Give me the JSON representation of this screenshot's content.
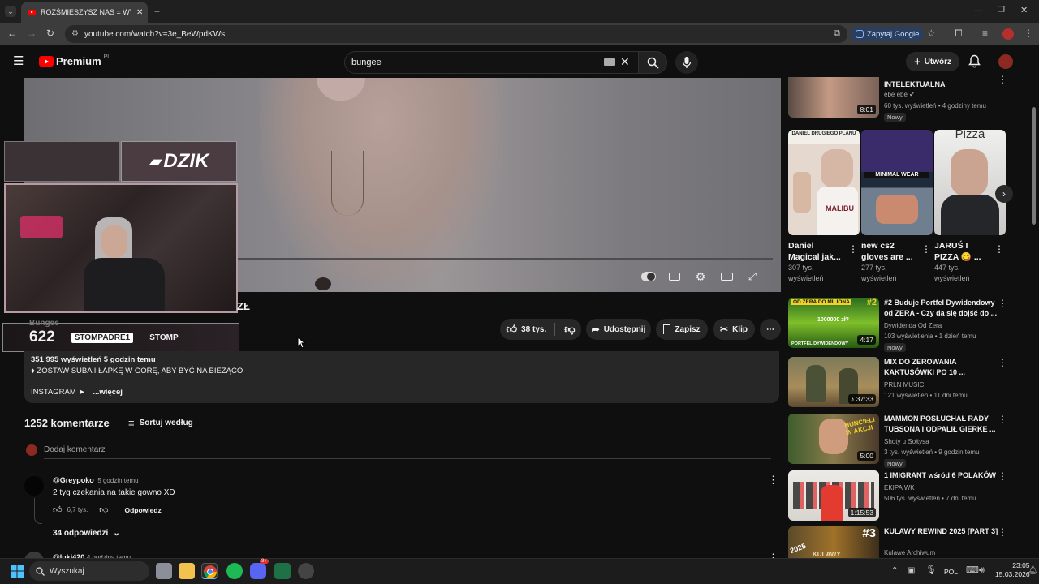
{
  "browser": {
    "tab_title": "ROZŚMIESZYSZ NAS = WYGRY",
    "url": "youtube.com/watch?v=3e_BeWpdKWs",
    "ask_google": "Zapytaj Google"
  },
  "youtube": {
    "logo_text": "Premium",
    "logo_region": "PL",
    "search_value": "bungee",
    "create_label": "Utwórz"
  },
  "player": {
    "overlay_brand": "DZIK",
    "overlay_count": "622",
    "overlay_social1": "STOMPADRE1",
    "overlay_social2": "STOMP"
  },
  "video": {
    "title_fragment": "ZŁ",
    "channel": "Bungee",
    "likes": "38 tys.",
    "share": "Udostępnij",
    "save": "Zapisz",
    "clip": "Klip",
    "views_line": "351 995 wyświetleń  5 godzin temu",
    "desc_line": "♦ ZOSTAW SUBA I ŁAPKĘ W GÓRĘ, ABY BYĆ NA BIEŻĄCO",
    "instagram": "INSTAGRAM ►",
    "more": "...więcej"
  },
  "comments": {
    "count": "1252 komentarze",
    "sort": "Sortuj według",
    "add_placeholder": "Dodaj komentarz",
    "items": [
      {
        "author": "@Greypoko",
        "time": "5 godzin temu",
        "text": "2 tyg czekania na takie gowno XD",
        "likes": "6,7 tys.",
        "reply": "Odpowiedz",
        "replies": "34 odpowiedzi"
      },
      {
        "author": "@luki420",
        "time": "4 godziny temu"
      }
    ]
  },
  "sidebar": {
    "top": {
      "title": "INTELEKTUALNA",
      "channel": "ebe ebe",
      "meta": "60 tys. wyświetleń • 4 godziny temu",
      "badge": "Nowy",
      "duration": "8:01"
    },
    "shorts": [
      {
        "title": "Daniel Magical jak...",
        "views": "307 tys. wyświetleń",
        "thumb_text": "DANIEL DRUGIEGO PLANU",
        "thumb_text2": "MALIBU"
      },
      {
        "title": "new cs2 gloves are ...",
        "views": "277 tys. wyświetleń",
        "thumb_text": "MINIMAL WEAR"
      },
      {
        "title": "JARUŚ I PIZZA 😋 ...",
        "views": "447 tys. wyświetleń",
        "thumb_text": "Pizza"
      }
    ],
    "videos": [
      {
        "title": "#2 Buduje Portfel Dywidendowy od ZERA - Czy da się dojść do ...",
        "channel": "Dywidenda Od Zera",
        "meta": "103 wyświetlenia • 1 dzień temu",
        "duration": "4:17",
        "badge": "Nowy",
        "thumb_top": "OD ZERA DO MILIONA",
        "thumb_num": "#2",
        "thumb_mid": "1000000 zł?",
        "thumb_bottom": "PORTFEL DYWIDENDOWY"
      },
      {
        "title": "MIX DO ZEROWANIA KAKTUSÓWKI PO 10 ...",
        "channel": "PRLN MUSIC",
        "meta": "121 wyświetleń • 11 dni temu",
        "duration": "37:33"
      },
      {
        "title": "MAMMON POSŁUCHAŁ RADY TUBSONA I ODPALIŁ  GIERKE ...",
        "channel": "Shoty u Sołtysa",
        "meta": "3 tys. wyświetleń • 9 godzin temu",
        "duration": "5:00",
        "badge": "Nowy",
        "thumb_text": "HUNCIELI W AKCJI"
      },
      {
        "title": "1 IMIGRANT wśród 6 POLAKÓW",
        "channel": "EKIPA WK",
        "meta": "506 tys. wyświetleń • 7 dni temu",
        "duration": "1:15:53"
      },
      {
        "title": "KULAWY REWIND 2025 [PART 3]",
        "channel": "Kulawe Archiwum",
        "thumb_text": "#3",
        "thumb_year": "2025",
        "thumb_bottom": "KULAWY"
      }
    ]
  },
  "taskbar": {
    "search": "Wyszukaj",
    "lang": "POL",
    "time": "23:05",
    "date": "15.03.2026",
    "discord_badge": "9+"
  },
  "colors": {
    "yt_red": "#ff0000",
    "bg": "#0f0f0f",
    "chip": "#272727"
  }
}
